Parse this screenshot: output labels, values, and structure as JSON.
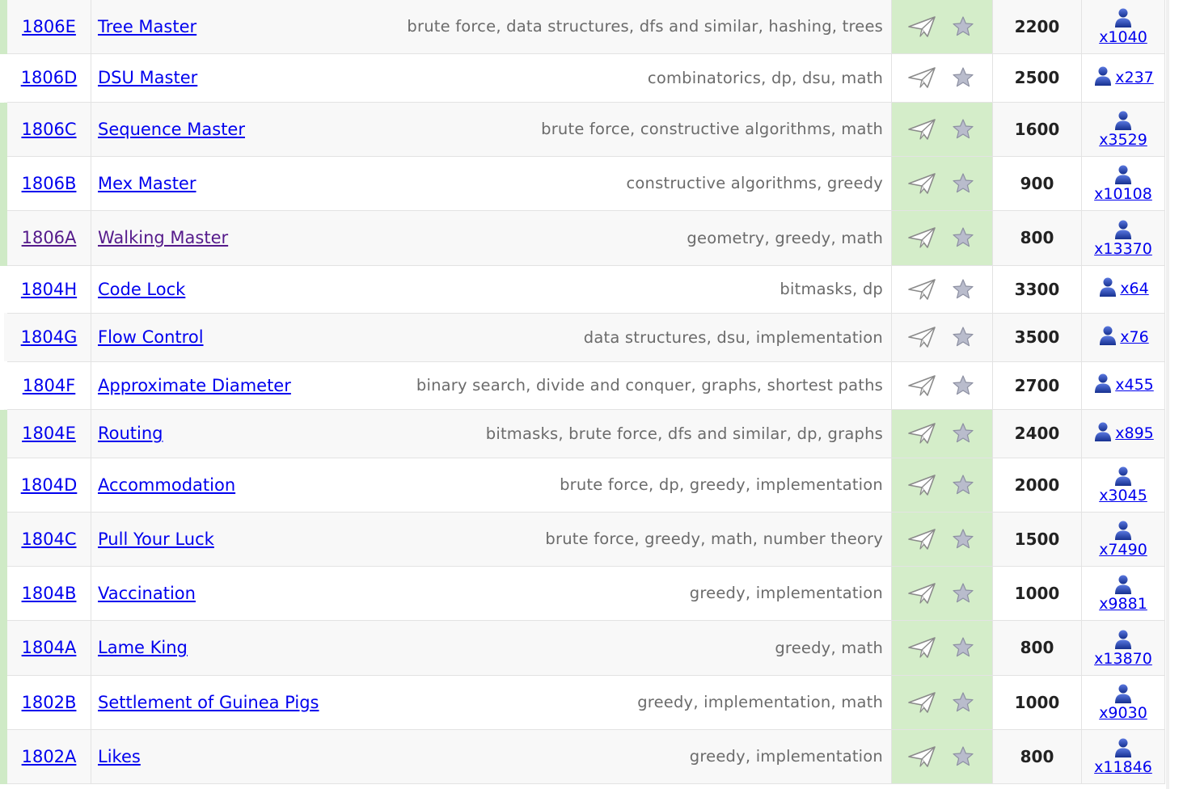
{
  "colors": {
    "accepted_bg": "#d4edc9",
    "accepted_strip": "#cfeac6",
    "link": "#0000ee",
    "visited": "#551a8b",
    "tags": "#6b6b6b"
  },
  "icons": {
    "submit": "paper-plane-icon",
    "favourite": "star-icon",
    "solvers": "user-icon"
  },
  "problems": [
    {
      "id": "1806E",
      "name": "Tree Master",
      "tags": [
        "brute force",
        "data structures",
        "dfs and similar",
        "hashing",
        "trees"
      ],
      "rating": "2200",
      "solved": "x1040",
      "accepted": true,
      "visited": false,
      "stacked": true,
      "striped": true,
      "height": 66
    },
    {
      "id": "1806D",
      "name": "DSU Master",
      "tags": [
        "combinatorics",
        "dp",
        "dsu",
        "math"
      ],
      "rating": "2500",
      "solved": "x237",
      "accepted": false,
      "visited": false,
      "stacked": false,
      "striped": false,
      "height": 60
    },
    {
      "id": "1806C",
      "name": "Sequence Master",
      "tags": [
        "brute force",
        "constructive algorithms",
        "math"
      ],
      "rating": "1600",
      "solved": "x3529",
      "accepted": true,
      "visited": false,
      "stacked": true,
      "striped": true,
      "height": 67
    },
    {
      "id": "1806B",
      "name": "Mex Master",
      "tags": [
        "constructive algorithms",
        "greedy"
      ],
      "rating": "900",
      "solved": "x10108",
      "accepted": true,
      "visited": false,
      "stacked": true,
      "striped": false,
      "height": 67
    },
    {
      "id": "1806A",
      "name": "Walking Master",
      "tags": [
        "geometry",
        "greedy",
        "math"
      ],
      "rating": "800",
      "solved": "x13370",
      "accepted": true,
      "visited": true,
      "stacked": true,
      "striped": true,
      "height": 68
    },
    {
      "id": "1804H",
      "name": "Code Lock",
      "tags": [
        "bitmasks",
        "dp"
      ],
      "rating": "3300",
      "solved": "x64",
      "accepted": false,
      "visited": false,
      "stacked": false,
      "striped": false,
      "height": 59
    },
    {
      "id": "1804G",
      "name": "Flow Control",
      "tags": [
        "data structures",
        "dsu",
        "implementation"
      ],
      "rating": "3500",
      "solved": "x76",
      "accepted": false,
      "visited": false,
      "stacked": false,
      "striped": true,
      "height": 60
    },
    {
      "id": "1804F",
      "name": "Approximate Diameter",
      "tags": [
        "binary search",
        "divide and conquer",
        "graphs",
        "shortest paths"
      ],
      "rating": "2700",
      "solved": "x455",
      "accepted": false,
      "visited": false,
      "stacked": false,
      "striped": false,
      "height": 59
    },
    {
      "id": "1804E",
      "name": "Routing",
      "tags": [
        "bitmasks",
        "brute force",
        "dfs and similar",
        "dp",
        "graphs"
      ],
      "rating": "2400",
      "solved": "x895",
      "accepted": true,
      "visited": false,
      "stacked": false,
      "striped": true,
      "height": 60
    },
    {
      "id": "1804D",
      "name": "Accommodation",
      "tags": [
        "brute force",
        "dp",
        "greedy",
        "implementation"
      ],
      "rating": "2000",
      "solved": "x3045",
      "accepted": true,
      "visited": false,
      "stacked": true,
      "striped": false,
      "height": 67
    },
    {
      "id": "1804C",
      "name": "Pull Your Luck",
      "tags": [
        "brute force",
        "greedy",
        "math",
        "number theory"
      ],
      "rating": "1500",
      "solved": "x7490",
      "accepted": true,
      "visited": false,
      "stacked": true,
      "striped": true,
      "height": 67
    },
    {
      "id": "1804B",
      "name": "Vaccination",
      "tags": [
        "greedy",
        "implementation"
      ],
      "rating": "1000",
      "solved": "x9881",
      "accepted": true,
      "visited": false,
      "stacked": true,
      "striped": false,
      "height": 67
    },
    {
      "id": "1804A",
      "name": "Lame King",
      "tags": [
        "greedy",
        "math"
      ],
      "rating": "800",
      "solved": "x13870",
      "accepted": true,
      "visited": false,
      "stacked": true,
      "striped": true,
      "height": 68
    },
    {
      "id": "1802B",
      "name": "Settlement of Guinea Pigs",
      "tags": [
        "greedy",
        "implementation",
        "math"
      ],
      "rating": "1000",
      "solved": "x9030",
      "accepted": true,
      "visited": false,
      "stacked": true,
      "striped": false,
      "height": 67
    },
    {
      "id": "1802A",
      "name": "Likes",
      "tags": [
        "greedy",
        "implementation"
      ],
      "rating": "800",
      "solved": "x11846",
      "accepted": true,
      "visited": false,
      "stacked": true,
      "striped": true,
      "height": 67
    }
  ]
}
